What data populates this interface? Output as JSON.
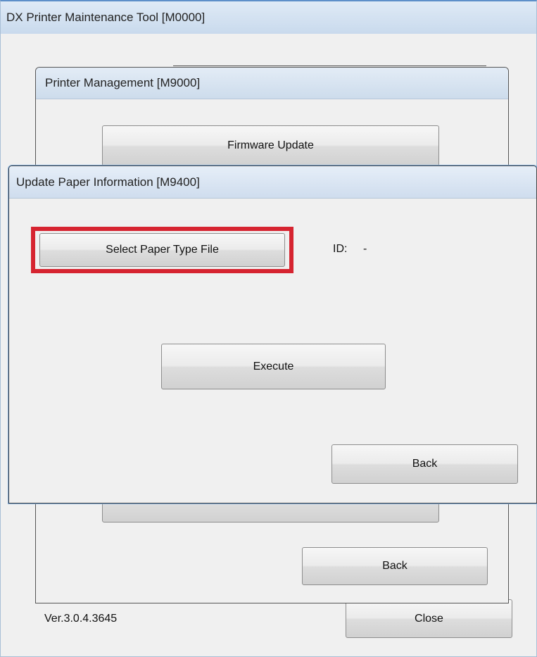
{
  "main_window": {
    "title": "DX Printer Maintenance Tool [M0000]",
    "version": "Ver.3.0.4.3645",
    "close_label": "Close"
  },
  "printer_management": {
    "title": "Printer Management [M9000]",
    "firmware_update_label": "Firmware Update",
    "back_label": "Back"
  },
  "update_paper": {
    "title": "Update Paper Information [M9400]",
    "select_file_label": "Select Paper Type File",
    "id_label": "ID:",
    "id_value": "-",
    "execute_label": "Execute",
    "back_label": "Back"
  },
  "highlight_color": "#d62430"
}
